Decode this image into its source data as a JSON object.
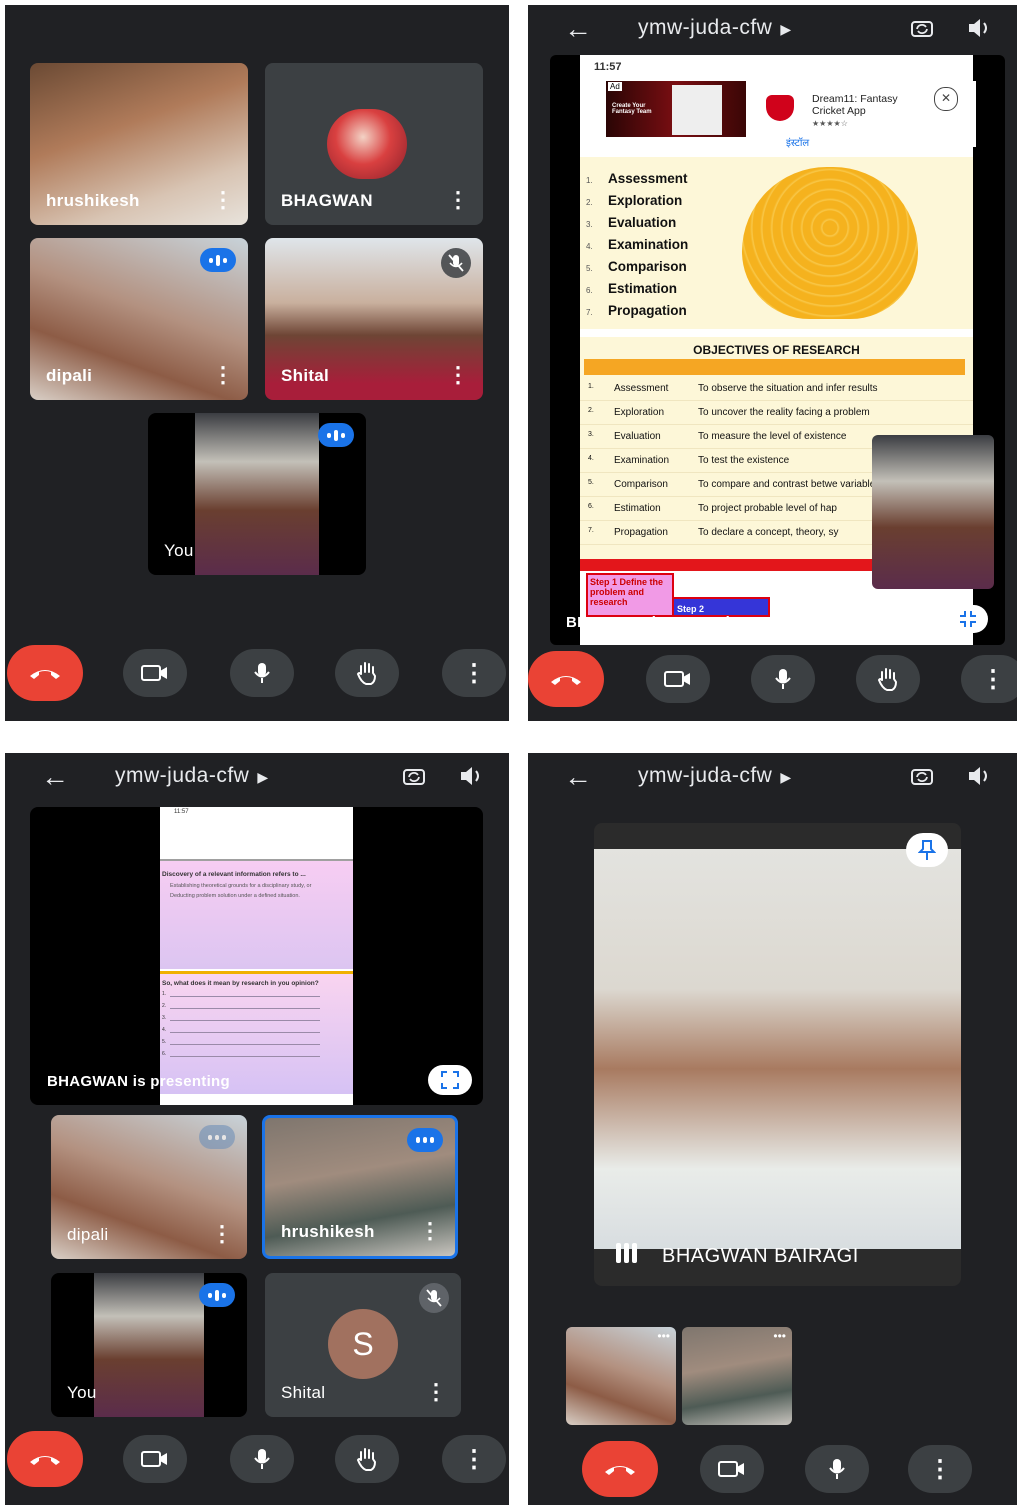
{
  "colors": {
    "panel_bg": "#202124",
    "tile_bg": "#3c4043",
    "end_call": "#ea4335",
    "speaking": "#1a73e8",
    "slide_bg": "#fdf7d8",
    "slide_header": "#f5a623"
  },
  "meeting_code": "ymw-juda-cfw",
  "panel1": {
    "tiles": [
      {
        "name": "hrushikesh"
      },
      {
        "name": "BHAGWAN"
      },
      {
        "name": "dipali"
      },
      {
        "name": "Shital"
      },
      {
        "name": "You"
      }
    ]
  },
  "panel2": {
    "status_time": "11:57",
    "ad": {
      "tag": "Ad",
      "headline": "Create Your Fantasy Team",
      "app_name": "Dream11: Fantasy Cricket App",
      "rating": "★★★★☆",
      "install": "इंस्टॉल"
    },
    "slide_list": [
      {
        "num": "1.",
        "label": "Assessment"
      },
      {
        "num": "2.",
        "label": "Exploration"
      },
      {
        "num": "3.",
        "label": "Evaluation"
      },
      {
        "num": "4.",
        "label": "Examination"
      },
      {
        "num": "5.",
        "label": "Comparison"
      },
      {
        "num": "6.",
        "label": "Estimation"
      },
      {
        "num": "7.",
        "label": "Propagation"
      }
    ],
    "objectives_title": "OBJECTIVES OF RESEARCH",
    "objectives": [
      {
        "num": "1.",
        "key": "Assessment",
        "value": "To observe the situation and infer results"
      },
      {
        "num": "2.",
        "key": "Exploration",
        "value": "To uncover the reality facing a problem"
      },
      {
        "num": "3.",
        "key": "Evaluation",
        "value": "To measure the level of existence"
      },
      {
        "num": "4.",
        "key": "Examination",
        "value": "To test the existence"
      },
      {
        "num": "5.",
        "key": "Comparison",
        "value": "To compare and contrast betwe variables"
      },
      {
        "num": "6.",
        "key": "Estimation",
        "value": "To project probable level of hap"
      },
      {
        "num": "7.",
        "key": "Propagation",
        "value": "To declare a concept, theory, sy"
      }
    ],
    "step1": "Step 1 Define the problem and research",
    "step2": "Step 2",
    "presenting": "BHAGWAN is presenting"
  },
  "panel3": {
    "status_time": "11:57",
    "slide_heading": "Discovery of a relevant information refers to ...",
    "slide_bullets": [
      "Establishing theoretical grounds for a disciplinary study, or",
      "Deducting problem solution under a defined situation."
    ],
    "question": "So, what does it mean by research in you opinion?",
    "blank_numbers": [
      "1.",
      "2.",
      "3.",
      "4.",
      "5.",
      "6."
    ],
    "presenting": "BHAGWAN is presenting",
    "tiles": [
      {
        "name": "dipali"
      },
      {
        "name": "hrushikesh"
      },
      {
        "name": "You"
      },
      {
        "name": "Shital",
        "initial": "S"
      }
    ]
  },
  "panel4": {
    "speaker": "BHAGWAN BAIRAGI",
    "thumbs_more": "•••"
  }
}
